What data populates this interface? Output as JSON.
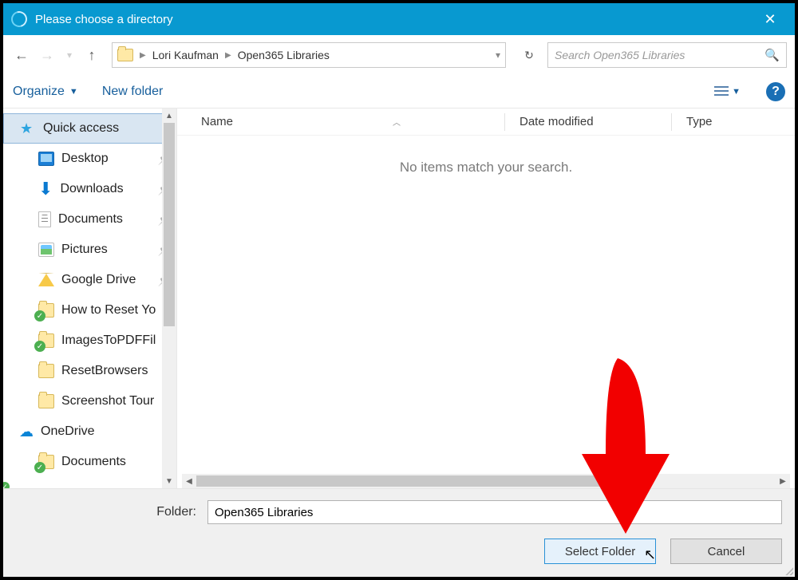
{
  "title": "Please choose a directory",
  "breadcrumb": {
    "seg1": "Lori Kaufman",
    "seg2": "Open365 Libraries"
  },
  "search": {
    "placeholder": "Search Open365 Libraries"
  },
  "toolbar": {
    "organize": "Organize",
    "newfolder": "New folder"
  },
  "columns": {
    "name": "Name",
    "date": "Date modified",
    "type": "Type"
  },
  "empty_message": "No items match your search.",
  "sidebar": [
    {
      "label": "Quick access",
      "icon": "star",
      "selected": true,
      "indent": false
    },
    {
      "label": "Desktop",
      "icon": "desktop",
      "pin": true,
      "indent": true
    },
    {
      "label": "Downloads",
      "icon": "down",
      "pin": true,
      "indent": true
    },
    {
      "label": "Documents",
      "icon": "doc",
      "pin": true,
      "indent": true
    },
    {
      "label": "Pictures",
      "icon": "pic",
      "pin": true,
      "indent": true
    },
    {
      "label": "Google Drive",
      "icon": "gdrive",
      "pin": true,
      "indent": true
    },
    {
      "label": "How to Reset Yo",
      "icon": "check",
      "indent": true
    },
    {
      "label": "ImagesToPDFFil",
      "icon": "check",
      "indent": true
    },
    {
      "label": "ResetBrowsers",
      "icon": "plain",
      "indent": true
    },
    {
      "label": "Screenshot Tour",
      "icon": "plain",
      "indent": true
    },
    {
      "label": "OneDrive",
      "icon": "cloud",
      "indent": false
    },
    {
      "label": "Documents",
      "icon": "check",
      "indent": true
    }
  ],
  "folder": {
    "label": "Folder:",
    "value": "Open365 Libraries"
  },
  "buttons": {
    "select": "Select Folder",
    "cancel": "Cancel"
  }
}
